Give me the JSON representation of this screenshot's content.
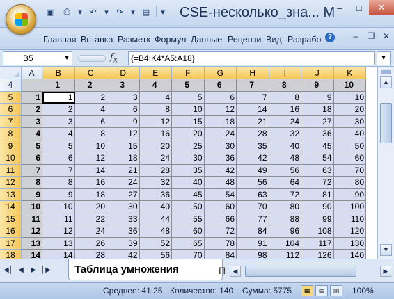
{
  "window": {
    "title": "CSE-несколько_зна... М"
  },
  "ribbon": {
    "tabs": [
      "Главная",
      "Вставка",
      "Разметк",
      "Формул",
      "Данные",
      "Рецензи",
      "Вид",
      "Разрабо"
    ]
  },
  "formula_bar": {
    "name_box": "B5",
    "formula": "{=B4:K4*A5:A18}"
  },
  "sheet": {
    "columns": [
      "A",
      "B",
      "C",
      "D",
      "E",
      "F",
      "G",
      "H",
      "I",
      "J",
      "K"
    ],
    "rows": [
      4,
      5,
      6,
      7,
      8,
      9,
      10,
      11,
      12,
      13,
      14,
      15,
      16,
      17,
      18
    ],
    "header_row": [
      1,
      2,
      3,
      4,
      5,
      6,
      7,
      8,
      9,
      10
    ],
    "multipliers": [
      1,
      2,
      3,
      4,
      5,
      6,
      7,
      8,
      9,
      10,
      11,
      12,
      13,
      14
    ],
    "active_cell": "B5"
  },
  "sheet_tabs": {
    "active": "Таблица умножения",
    "next_partial": "П"
  },
  "status_bar": {
    "average": "Среднее: 41,25",
    "count": "Количество: 140",
    "sum": "Сумма: 5775",
    "zoom": "100%"
  },
  "icons": [
    "office-button-icon",
    "save-icon",
    "undo-icon",
    "redo-icon",
    "dropdown-icon",
    "help-icon",
    "minimize-icon",
    "maximize-icon",
    "close-icon",
    "fx-icon",
    "scroll-up-icon",
    "scroll-down-icon"
  ]
}
